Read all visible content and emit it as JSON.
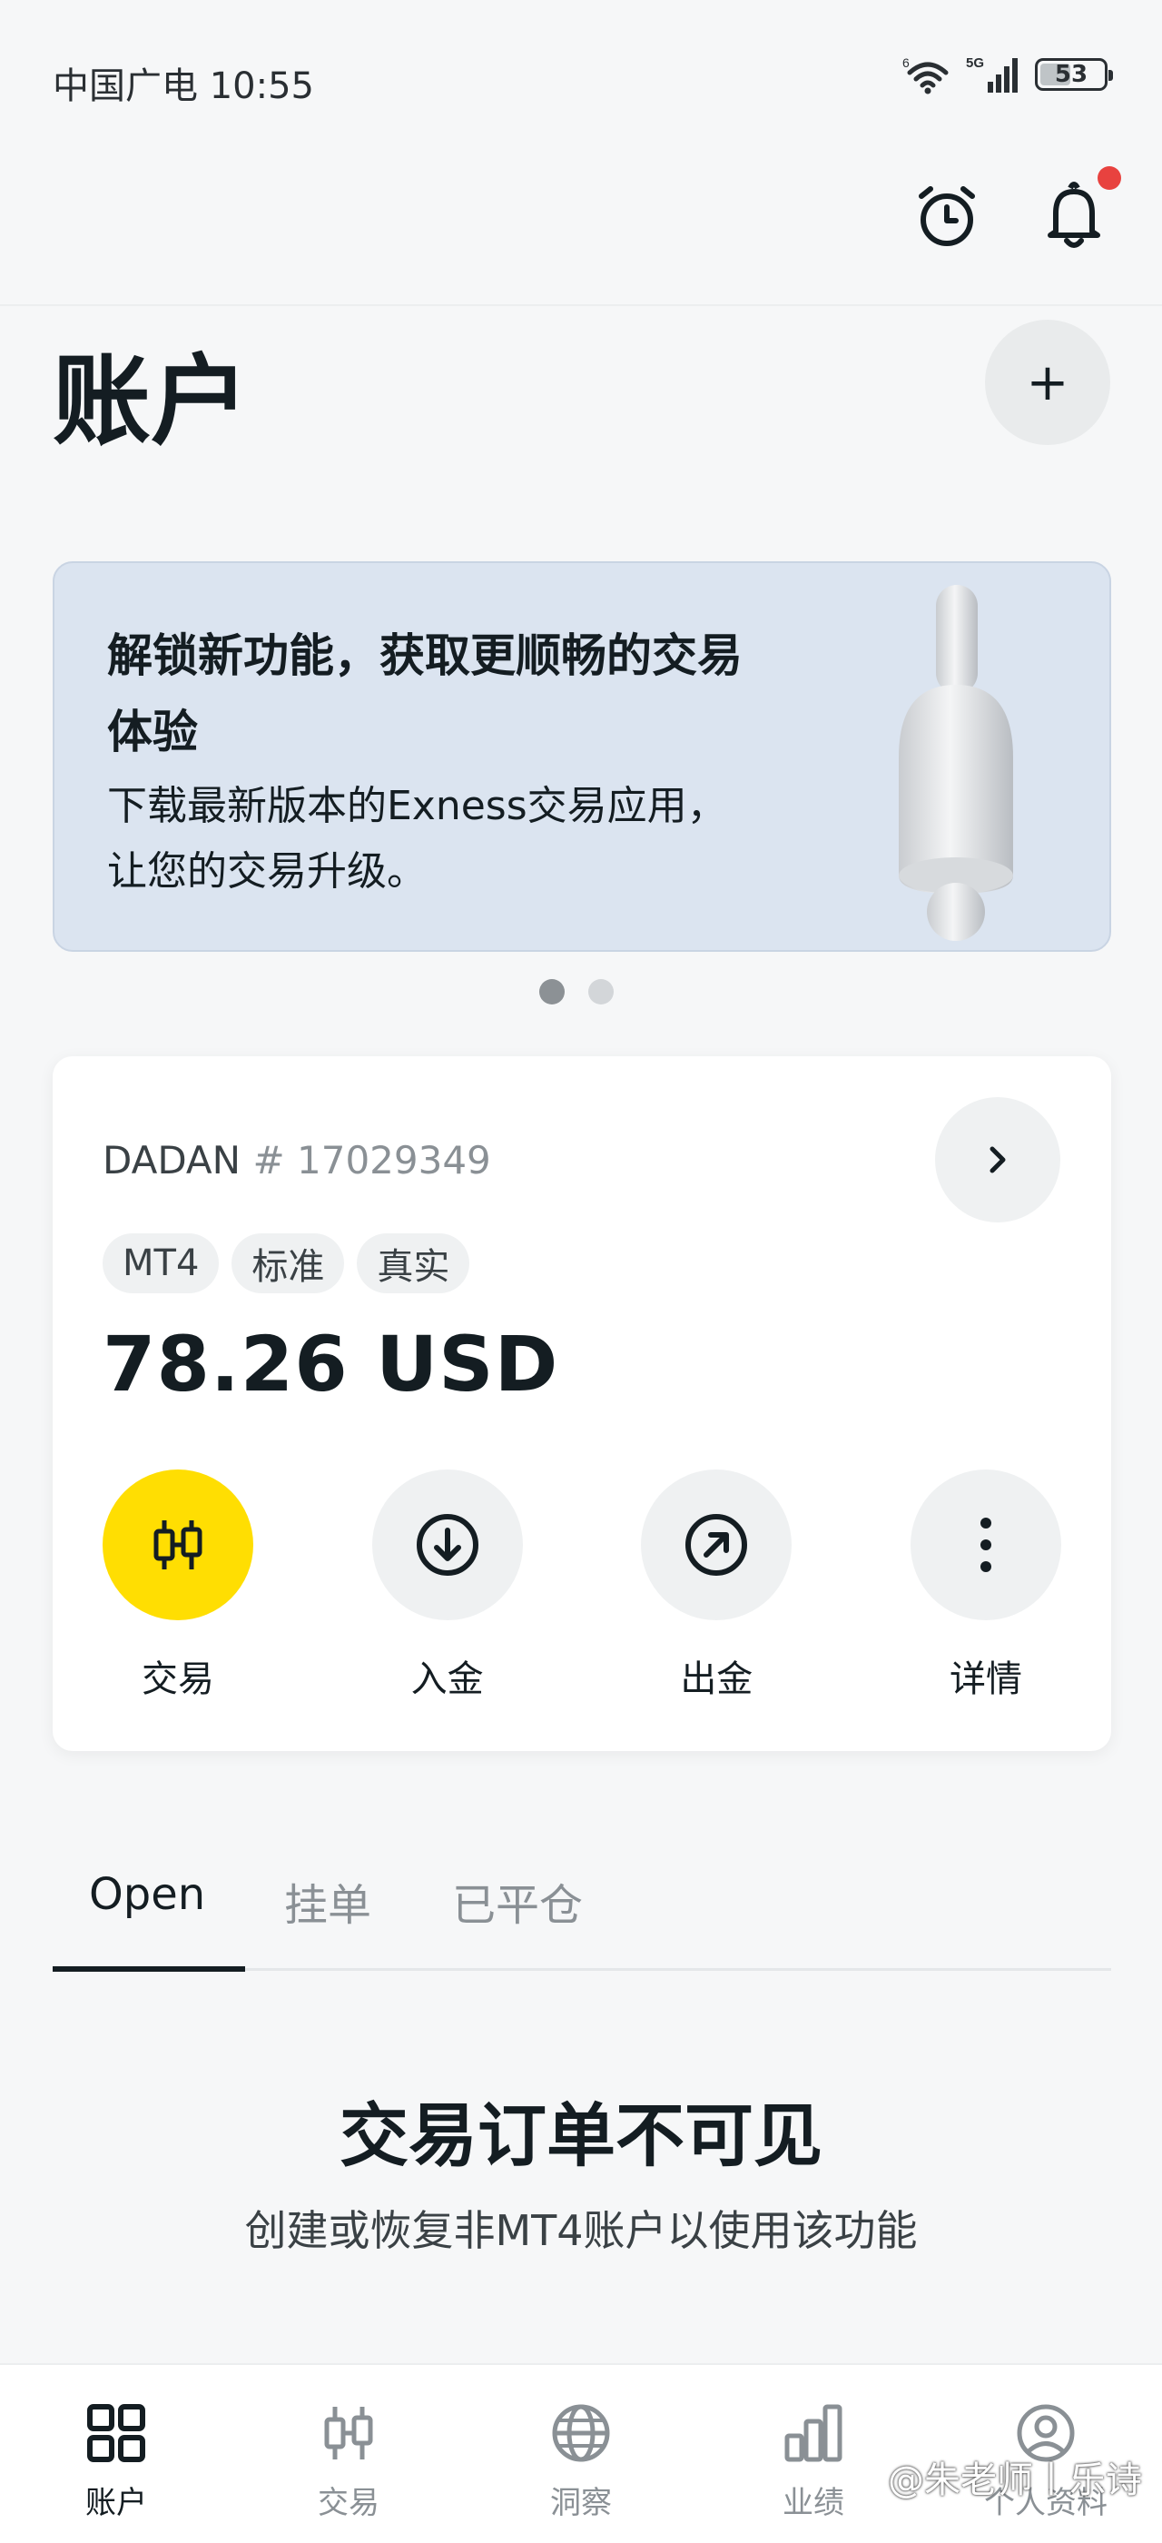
{
  "status_bar": {
    "time": "中国广电 10:55",
    "signal_label": "5G",
    "wifi_label": "6",
    "battery": "53",
    "battery_fraction": 0.53
  },
  "header": {
    "title": "账户",
    "add_label": "+"
  },
  "banner": {
    "title": "解锁新功能，获取更顺畅的交易体验",
    "text": "下载最新版本的Exness交易应用，让您的交易升级。",
    "page_count": 2,
    "active_page": 1
  },
  "account": {
    "name": "DADAN",
    "number": "# 17029349",
    "tags": [
      "MT4",
      "标准",
      "真实"
    ],
    "balance": "78.26 USD",
    "actions": [
      "交易",
      "入金",
      "出金",
      "详情"
    ]
  },
  "tabs": {
    "items": [
      "Open",
      "挂单",
      "已平仓"
    ],
    "active": "Open"
  },
  "empty_state": {
    "title": "交易订单不可见",
    "subtitle": "创建或恢复非MT4账户以使用该功能"
  },
  "bottom_nav": {
    "items": [
      "账户",
      "交易",
      "洞察",
      "业绩",
      "个人资料"
    ],
    "active": "账户"
  },
  "watermark": "@朱老师丨乐诗",
  "colors": {
    "accent": "#ffde02",
    "notification_dot": "#e8423f",
    "banner_bg": "#dbe4f0"
  }
}
